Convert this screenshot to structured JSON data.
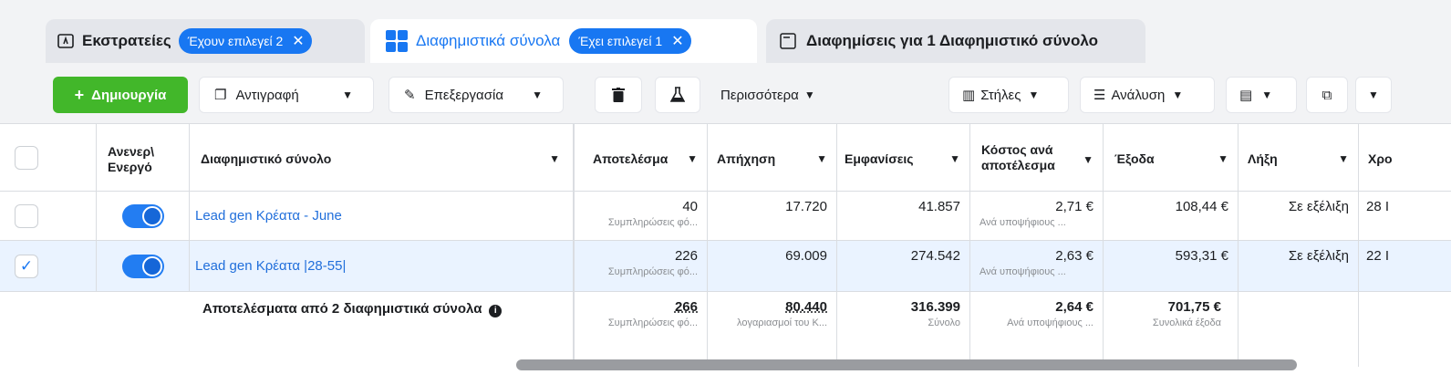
{
  "tabs": [
    {
      "label": "Εκστρατείες",
      "pill": "Έχουν επιλεγεί 2",
      "icon": "campaign-icon"
    },
    {
      "label": "Διαφημιστικά σύνολα",
      "pill": "Έχει επιλεγεί 1",
      "icon": "adsets-grid-icon",
      "active": true
    },
    {
      "label": "Διαφημίσεις για 1 Διαφημιστικό σύνολο",
      "icon": "ad-window-icon"
    }
  ],
  "toolbar": {
    "create": "Δημιουργία",
    "duplicate": "Αντιγραφή",
    "edit": "Επεξεργασία",
    "more": "Περισσότερα",
    "columns": "Στήλες",
    "breakdown": "Ανάλυση"
  },
  "columns": {
    "onoff": "Ανενεργό / Ενεργό",
    "onoff_l1": "Ανενερ\\",
    "onoff_l2": "Ενεργό",
    "adset": "Διαφημιστικό σύνολο",
    "results": "Αποτελέσμα",
    "reach": "Απήχηση",
    "impressions": "Εμφανίσεις",
    "cpr_l1": "Κόστος ανά",
    "cpr_l2": "αποτέλεσμα",
    "spent": "Έξοδα",
    "ends": "Λήξη",
    "more": "Χρο"
  },
  "rows": [
    {
      "name": "Lead gen Κρέατα - June",
      "checked": false,
      "results": "40",
      "results_sub": "Συμπληρώσεις φό...",
      "reach": "17.720",
      "impressions": "41.857",
      "cpr": "2,71 €",
      "cpr_sub": "Ανά υποψήφιους ...",
      "spent": "108,44 €",
      "ends": "Σε εξέλιξη",
      "extra": "28 Ι"
    },
    {
      "name": "Lead gen Κρέατα |28-55|",
      "checked": true,
      "results": "226",
      "results_sub": "Συμπληρώσεις φό...",
      "reach": "69.009",
      "impressions": "274.542",
      "cpr": "2,63 €",
      "cpr_sub": "Ανά υποψήφιους ...",
      "spent": "593,31 €",
      "ends": "Σε εξέλιξη",
      "extra": "22 Ι"
    }
  ],
  "totals": {
    "label": "Αποτελέσματα από 2 διαφημιστικά σύνολα",
    "results": "266",
    "results_sub": "Συμπληρώσεις φό...",
    "reach": "80.440",
    "reach_sub": "λογαριασμοί του Κ...",
    "impressions": "316.399",
    "impressions_sub": "Σύνολο",
    "cpr": "2,64 €",
    "cpr_sub": "Ανά υποψήφιους ...",
    "spent": "701,75 €",
    "spent_sub": "Συνολικά έξοδα"
  },
  "colors": {
    "accent": "#1877f2",
    "create": "#42b72a"
  }
}
